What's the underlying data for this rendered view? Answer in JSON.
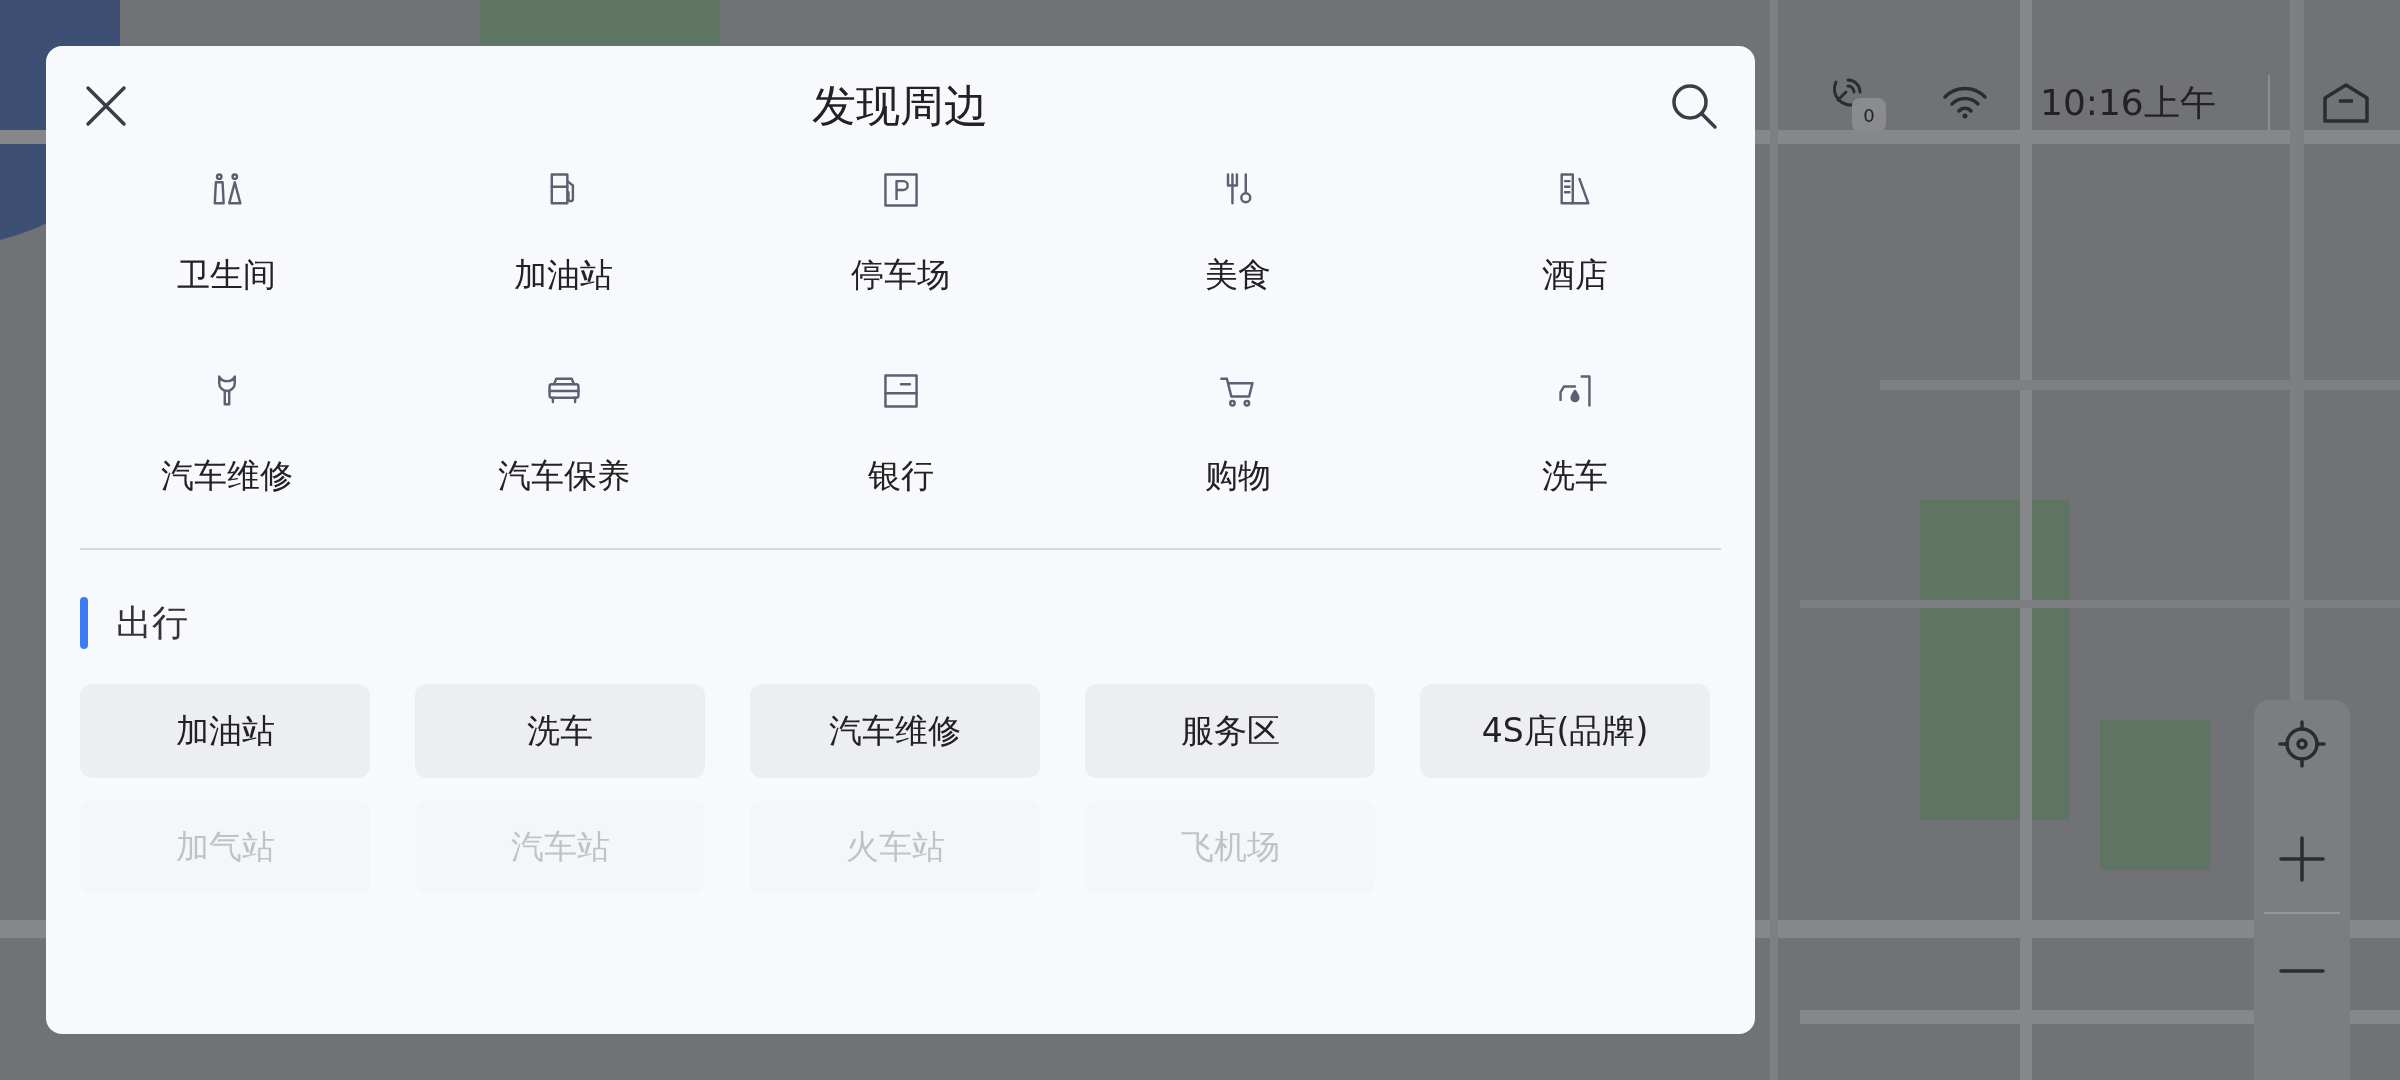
{
  "panel": {
    "title": "发现周边",
    "categories": [
      {
        "label": "卫生间"
      },
      {
        "label": "加油站"
      },
      {
        "label": "停车场"
      },
      {
        "label": "美食"
      },
      {
        "label": "酒店"
      },
      {
        "label": "汽车维修"
      },
      {
        "label": "汽车保养"
      },
      {
        "label": "银行"
      },
      {
        "label": "购物"
      },
      {
        "label": "洗车"
      }
    ],
    "section": {
      "title": "出行",
      "rows": [
        {
          "faded": false,
          "chips": [
            "加油站",
            "洗车",
            "汽车维修",
            "服务区",
            "4S店(品牌)"
          ]
        },
        {
          "faded": true,
          "chips": [
            "加气站",
            "汽车站",
            "火车站",
            "飞机场"
          ]
        }
      ]
    }
  },
  "status_bar": {
    "signal_badge": "0",
    "time": "10:16上午"
  }
}
